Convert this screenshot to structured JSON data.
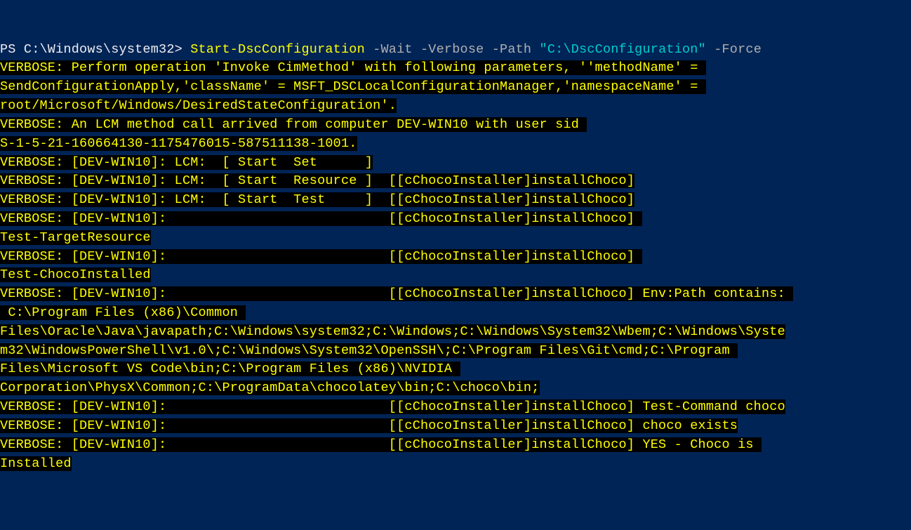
{
  "prompt": {
    "prefix": "PS C:\\Windows\\system32> ",
    "command": "Start-DscConfiguration",
    "param_wait": " -Wait",
    "param_verbose": " -Verbose",
    "param_path_flag": " -Path ",
    "param_path_value": "\"C:\\DscConfiguration\"",
    "param_force": " -Force"
  },
  "output": {
    "line1a": "VERBOSE: Perform operation 'Invoke CimMethod' with following parameters, ''methodName' = ",
    "line1b": "SendConfigurationApply,'className' = MSFT_DSCLocalConfigurationManager,'namespaceName' = ",
    "line1c": "root/Microsoft/Windows/DesiredStateConfiguration'.",
    "line2a": "VERBOSE: An LCM method call arrived from computer DEV-WIN10 with user sid ",
    "line2b": "S-1-5-21-160664130-1175476015-587511138-1001.",
    "line3": "VERBOSE: [DEV-WIN10]: LCM:  [ Start  Set      ]",
    "line4": "VERBOSE: [DEV-WIN10]: LCM:  [ Start  Resource ]  [[cChocoInstaller]installChoco]",
    "line5": "VERBOSE: [DEV-WIN10]: LCM:  [ Start  Test     ]  [[cChocoInstaller]installChoco]",
    "line6": "VERBOSE: [DEV-WIN10]:                            [[cChocoInstaller]installChoco] ",
    "line6b": "Test-TargetResource",
    "line7": "VERBOSE: [DEV-WIN10]:                            [[cChocoInstaller]installChoco] ",
    "line7b": "Test-ChocoInstalled",
    "line8": "VERBOSE: [DEV-WIN10]:                            [[cChocoInstaller]installChoco] Env:Path contains: ",
    "line8b": " C:\\Program Files (x86)\\Common ",
    "line8c": "Files\\Oracle\\Java\\javapath;C:\\Windows\\system32;C:\\Windows;C:\\Windows\\System32\\Wbem;C:\\Windows\\Syste",
    "line8d": "m32\\WindowsPowerShell\\v1.0\\;C:\\Windows\\System32\\OpenSSH\\;C:\\Program Files\\Git\\cmd;C:\\Program ",
    "line8e": "Files\\Microsoft VS Code\\bin;C:\\Program Files (x86)\\NVIDIA ",
    "line8f": "Corporation\\PhysX\\Common;C:\\ProgramData\\chocolatey\\bin;C:\\choco\\bin;",
    "line9": "VERBOSE: [DEV-WIN10]:                            [[cChocoInstaller]installChoco] Test-Command choco",
    "line10": "VERBOSE: [DEV-WIN10]:                            [[cChocoInstaller]installChoco] choco exists",
    "line11": "VERBOSE: [DEV-WIN10]:                            [[cChocoInstaller]installChoco] YES - Choco is ",
    "line11b": "Installed"
  }
}
